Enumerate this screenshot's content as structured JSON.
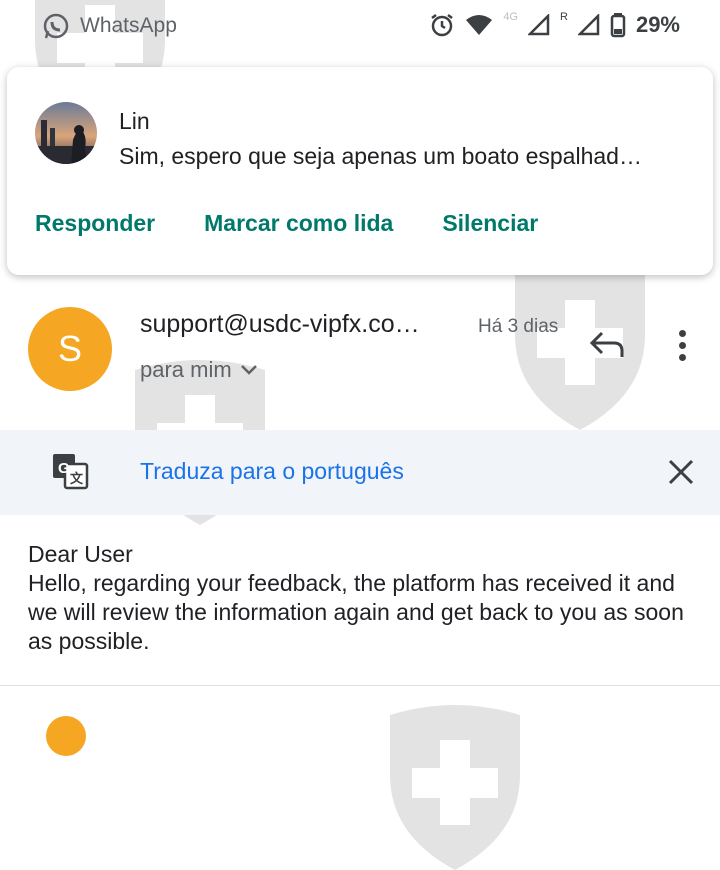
{
  "status_bar": {
    "app_name": "WhatsApp",
    "app_icon": "whatsapp-icon",
    "network_label": "4G",
    "roaming_label": "R",
    "battery": "29%"
  },
  "notification": {
    "sender": "Lin",
    "message": "Sim, espero que seja apenas um boato espalhad…",
    "actions": [
      "Responder",
      "Marcar como lida",
      "Silenciar"
    ],
    "accent": "#00796b"
  },
  "email": {
    "avatar_letter": "S",
    "avatar_color": "#f5a623",
    "sender": "support@usdc-vipfx.co…",
    "time": "Há 3 dias",
    "recipient": "para mim"
  },
  "translate": {
    "label": "Traduza para o português",
    "color": "#1a73e8"
  },
  "message": {
    "greeting": "Dear User",
    "body": "Hello, regarding your feedback, the platform has received it and we will review the information again and get back to you as soon as possible."
  }
}
